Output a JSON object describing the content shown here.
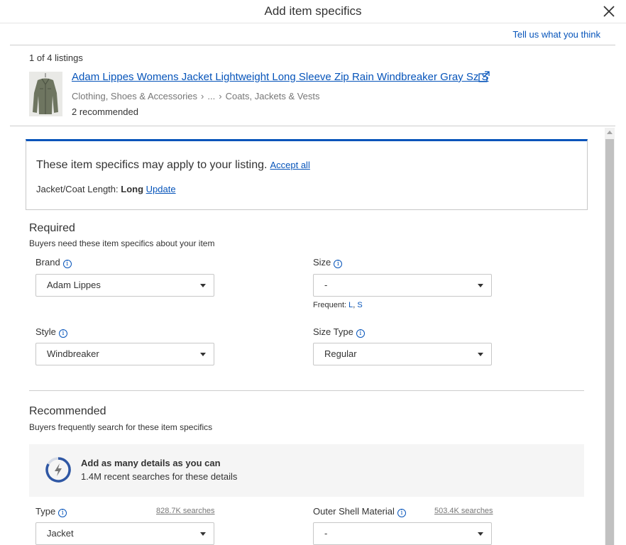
{
  "header": {
    "title": "Add item specifics",
    "feedback_link": "Tell us what you think"
  },
  "listing": {
    "count": "1 of 4 listings",
    "title": "Adam Lippes Womens Jacket Lightweight Long Sleeve Zip Rain Windbreaker Gray Sz S",
    "breadcrumb": [
      "Clothing, Shoes & Accessories",
      "...",
      "Coats, Jackets & Vests"
    ],
    "recommended_count": "2 recommended"
  },
  "suggestion": {
    "text": "These item specifics may apply to your listing.",
    "accept_all": "Accept all",
    "item_label": "Jacket/Coat Length:",
    "item_value": "Long",
    "update_label": "Update"
  },
  "required": {
    "title": "Required",
    "subtitle": "Buyers need these item specifics about your item",
    "fields": {
      "brand": {
        "label": "Brand",
        "value": "Adam Lippes"
      },
      "size": {
        "label": "Size",
        "value": "-"
      },
      "style": {
        "label": "Style",
        "value": "Windbreaker"
      },
      "size_type": {
        "label": "Size Type",
        "value": "Regular"
      }
    },
    "frequent": {
      "label": "Frequent:",
      "options": [
        "L",
        "S"
      ],
      "separator": ", "
    }
  },
  "recommended": {
    "title": "Recommended",
    "subtitle": "Buyers frequently search for these item specifics",
    "tip": {
      "title": "Add as many details as you can",
      "subtitle": "1.4M recent searches for these details"
    },
    "fields": {
      "type": {
        "label": "Type",
        "searches": "828.7K searches",
        "value": "Jacket"
      },
      "outer_shell": {
        "label": "Outer Shell Material",
        "searches": "503.4K searches",
        "value": "-"
      }
    }
  },
  "colors": {
    "link": "#0654ba",
    "text": "#333333",
    "muted": "#767676",
    "border": "#c7c7c7"
  },
  "icons": {
    "close": "close-icon",
    "external": "external-link-icon",
    "info": "info-icon",
    "caret": "chevron-down-icon",
    "tip": "lightning-icon"
  }
}
